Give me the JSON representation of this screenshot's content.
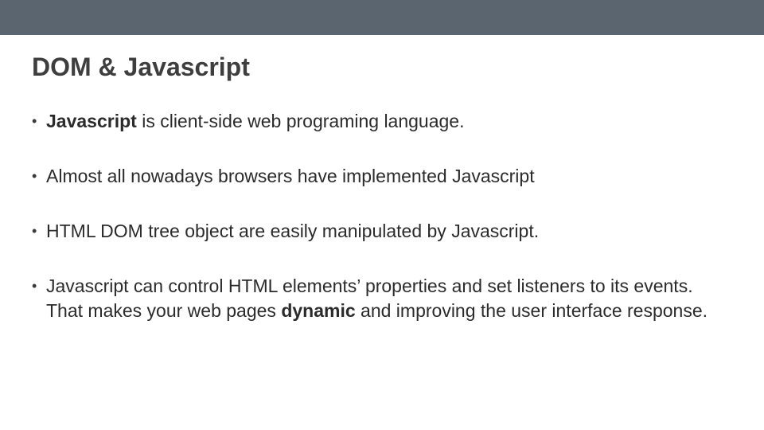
{
  "slide": {
    "title": "DOM & Javascript",
    "bullets": [
      {
        "bold_lead": "Javascript",
        "rest": " is client-side web programing language."
      },
      {
        "plain": "Almost all nowadays browsers have implemented Javascript"
      },
      {
        "plain": "HTML DOM tree object are easily manipulated by Javascript."
      },
      {
        "pre": "Javascript can control HTML elements’ properties and set listeners to its events. That makes your web pages ",
        "bold_mid": "dynamic",
        "post": " and improving the user interface response."
      }
    ]
  }
}
